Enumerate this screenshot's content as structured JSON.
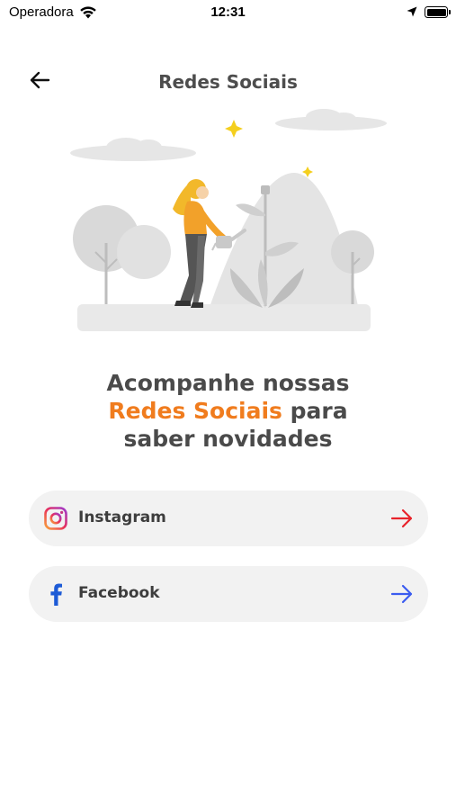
{
  "status_bar": {
    "carrier": "Operadora",
    "time": "12:31"
  },
  "header": {
    "title": "Redes Sociais"
  },
  "headline": {
    "line1": "Acompanhe nossas",
    "highlight": "Redes Sociais",
    "line2_rest": " para",
    "line3": "saber novidades"
  },
  "social_links": [
    {
      "label": "Instagram",
      "icon": "instagram-icon",
      "arrow_color": "#e8232b"
    },
    {
      "label": "Facebook",
      "icon": "facebook-icon",
      "arrow_color": "#3b5cf0"
    }
  ],
  "colors": {
    "accent": "#f07c1e",
    "button_bg": "#f2f2f2",
    "facebook_blue": "#1d5bd6"
  }
}
